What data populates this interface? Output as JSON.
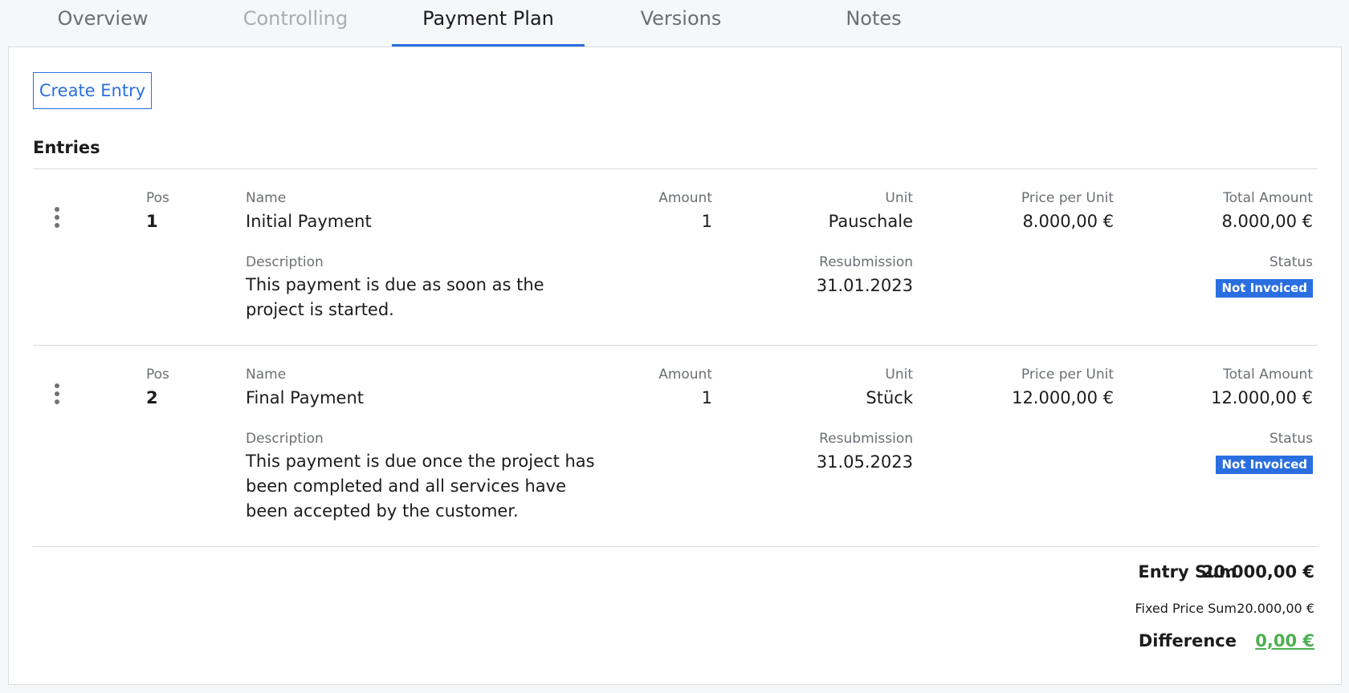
{
  "tabs": [
    {
      "label": "Overview",
      "state": "normal"
    },
    {
      "label": "Controlling",
      "state": "disabled"
    },
    {
      "label": "Payment Plan",
      "state": "active"
    },
    {
      "label": "Versions",
      "state": "normal"
    },
    {
      "label": "Notes",
      "state": "normal"
    }
  ],
  "toolbar": {
    "create_label": "Create Entry"
  },
  "entries_title": "Entries",
  "labels": {
    "pos": "Pos",
    "name": "Name",
    "amount": "Amount",
    "unit": "Unit",
    "price_per_unit": "Price per Unit",
    "total_amount": "Total Amount",
    "description": "Description",
    "resubmission": "Resubmission",
    "status": "Status"
  },
  "entries": [
    {
      "pos": "1",
      "name": "Initial Payment",
      "amount": "1",
      "unit": "Pauschale",
      "price_per_unit": "8.000,00 €",
      "total_amount": "8.000,00 €",
      "description": "This payment is due as soon as the project is started.",
      "resubmission": "31.01.2023",
      "status": "Not Invoiced"
    },
    {
      "pos": "2",
      "name": "Final Payment",
      "amount": "1",
      "unit": "Stück",
      "price_per_unit": "12.000,00 €",
      "total_amount": "12.000,00 €",
      "description": "This payment is due once the project has been completed and all services have been accepted by the customer.",
      "resubmission": "31.05.2023",
      "status": "Not Invoiced"
    }
  ],
  "summary": {
    "entry_sum_label": "Entry Sum",
    "entry_sum_value": "20.000,00 €",
    "fixed_price_sum_label": "Fixed Price Sum",
    "fixed_price_sum_value": "20.000,00 €",
    "difference_label": "Difference",
    "difference_value": "0,00 €"
  },
  "colors": {
    "accent": "#2a6fe0",
    "status_badge": "#2a6fe0",
    "difference_ok": "#4caf50"
  },
  "icons": {
    "entry_menu": "more-vertical-icon"
  }
}
